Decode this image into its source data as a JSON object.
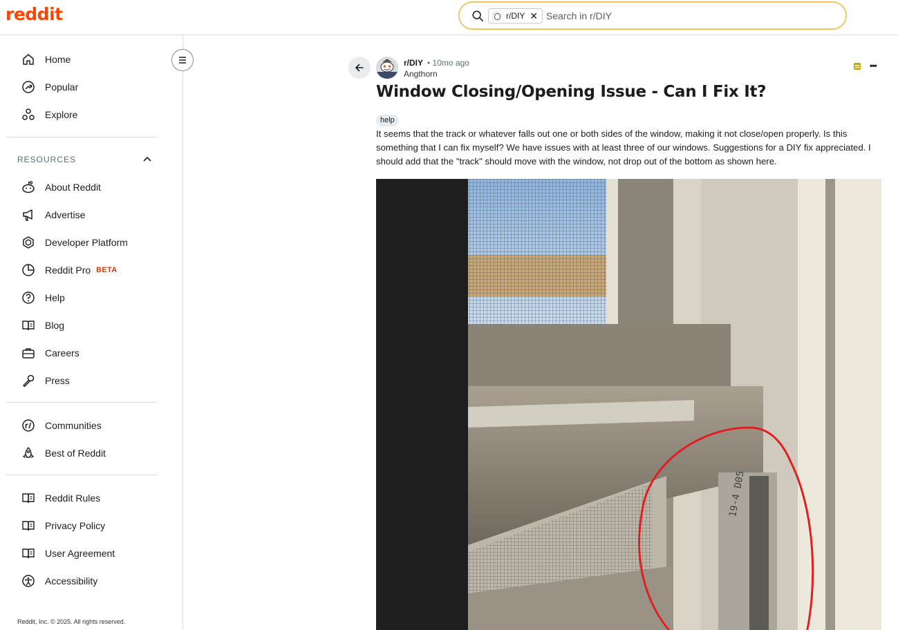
{
  "header": {
    "logo": "reddit",
    "search": {
      "chip_label": "r/DIY",
      "chip_remove": "✕",
      "placeholder": "Search in r/DIY"
    }
  },
  "sidebar": {
    "main_nav": [
      {
        "label": "Home",
        "icon": "home-icon"
      },
      {
        "label": "Popular",
        "icon": "popular-icon"
      },
      {
        "label": "Explore",
        "icon": "explore-icon"
      }
    ],
    "resources_heading": "RESOURCES",
    "resources": [
      {
        "label": "About Reddit",
        "icon": "reddit-alien-icon"
      },
      {
        "label": "Advertise",
        "icon": "megaphone-icon"
      },
      {
        "label": "Developer Platform",
        "icon": "cube-icon"
      },
      {
        "label": "Reddit Pro",
        "icon": "pie-chart-icon",
        "badge": "BETA"
      },
      {
        "label": "Help",
        "icon": "help-icon"
      },
      {
        "label": "Blog",
        "icon": "book-icon"
      },
      {
        "label": "Careers",
        "icon": "briefcase-icon"
      },
      {
        "label": "Press",
        "icon": "microphone-icon"
      }
    ],
    "community_nav": [
      {
        "label": "Communities",
        "icon": "communities-icon"
      },
      {
        "label": "Best of Reddit",
        "icon": "rocket-icon"
      }
    ],
    "policy_nav": [
      {
        "label": "Reddit Rules",
        "icon": "rules-book-icon"
      },
      {
        "label": "Privacy Policy",
        "icon": "privacy-book-icon"
      },
      {
        "label": "User Agreement",
        "icon": "agreement-book-icon"
      },
      {
        "label": "Accessibility",
        "icon": "accessibility-icon"
      }
    ],
    "footer": "Reddit, Inc. © 2025. All rights reserved."
  },
  "post": {
    "subreddit": "r/DIY",
    "separator": "•",
    "time_ago": "10mo ago",
    "author": "Angthorn",
    "title": "Window Closing/Opening Issue - Can I Fix It?",
    "flair": "help",
    "body": "It seems that the track or whatever falls out one or both sides of the window, making it not close/open properly. Is this something that I can fix myself? We have issues with at least three of our windows. Suggestions for a DIY fix appreciated. I should add that the \"track\" should move with the window, not drop out of the bottom as shown here.",
    "more_options": "•••"
  },
  "colors": {
    "brand": "#ff4500",
    "beta": "#d93a00",
    "section_heading": "#576f76",
    "search_focus": "#e8b84a",
    "annotation_circle": "#e02020"
  }
}
